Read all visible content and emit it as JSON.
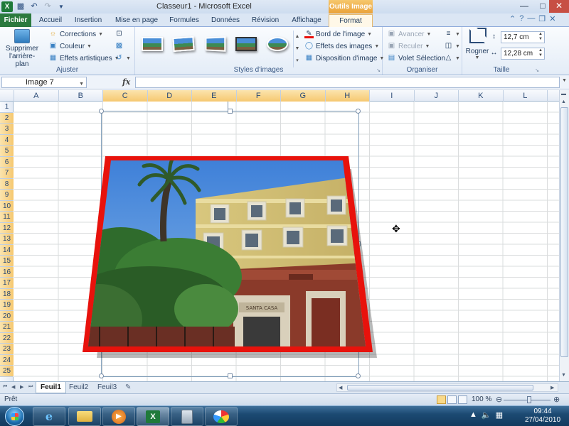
{
  "title_bar": {
    "title": "Classeur1 - Microsoft Excel",
    "context_group": "Outils Image",
    "controls": [
      "minimize-icon",
      "maximize-icon",
      "close-icon"
    ]
  },
  "tabs": {
    "file": "Fichier",
    "items": [
      "Accueil",
      "Insertion",
      "Mise en page",
      "Formules",
      "Données",
      "Révision",
      "Affichage"
    ],
    "active": "Format"
  },
  "ribbon": {
    "ajuster": {
      "label": "Ajuster",
      "remove_bg_line1": "Supprimer",
      "remove_bg_line2": "l'arrière-plan",
      "corrections": "Corrections",
      "couleur": "Couleur",
      "effets_artistiques": "Effets artistiques"
    },
    "styles": {
      "label": "Styles d'images",
      "bord": "Bord de l'image",
      "effets": "Effets des images",
      "disposition": "Disposition d'image"
    },
    "organiser": {
      "label": "Organiser",
      "avancer": "Avancer",
      "reculer": "Reculer",
      "volet": "Volet Sélection"
    },
    "taille": {
      "label": "Taille",
      "rogner": "Rogner",
      "height": "12,7 cm",
      "width": "12,28 cm"
    }
  },
  "formula_bar": {
    "name_box": "Image 7",
    "fx": "fx",
    "formula": ""
  },
  "grid": {
    "columns": [
      "A",
      "B",
      "C",
      "D",
      "E",
      "F",
      "G",
      "H",
      "I",
      "J",
      "K",
      "L"
    ],
    "selected_columns": [
      "C",
      "D",
      "E",
      "F",
      "G",
      "H"
    ],
    "rows": [
      "1",
      "2",
      "3",
      "4",
      "5",
      "6",
      "7",
      "8",
      "9",
      "10",
      "11",
      "12",
      "13",
      "14",
      "15",
      "16",
      "17",
      "18",
      "19",
      "20",
      "21",
      "22",
      "23",
      "24",
      "25"
    ],
    "selected_rows_from": 2,
    "selected_rows_to": 25
  },
  "picture": {
    "name": "Image 7",
    "border_color": "#e8120c",
    "sign_text": "SANTA CASA"
  },
  "sheets": {
    "tabs": [
      "Feuil1",
      "Feuil2",
      "Feuil3"
    ],
    "active": "Feuil1"
  },
  "status_bar": {
    "status": "Prêt",
    "zoom": "100 %"
  },
  "taskbar": {
    "apps": [
      "internet-explorer-icon",
      "folder-icon",
      "media-player-icon",
      "excel-icon",
      "calculator-icon",
      "paint-icon"
    ],
    "active_app": "excel-icon",
    "time": "09:44",
    "date": "27/04/2010"
  }
}
